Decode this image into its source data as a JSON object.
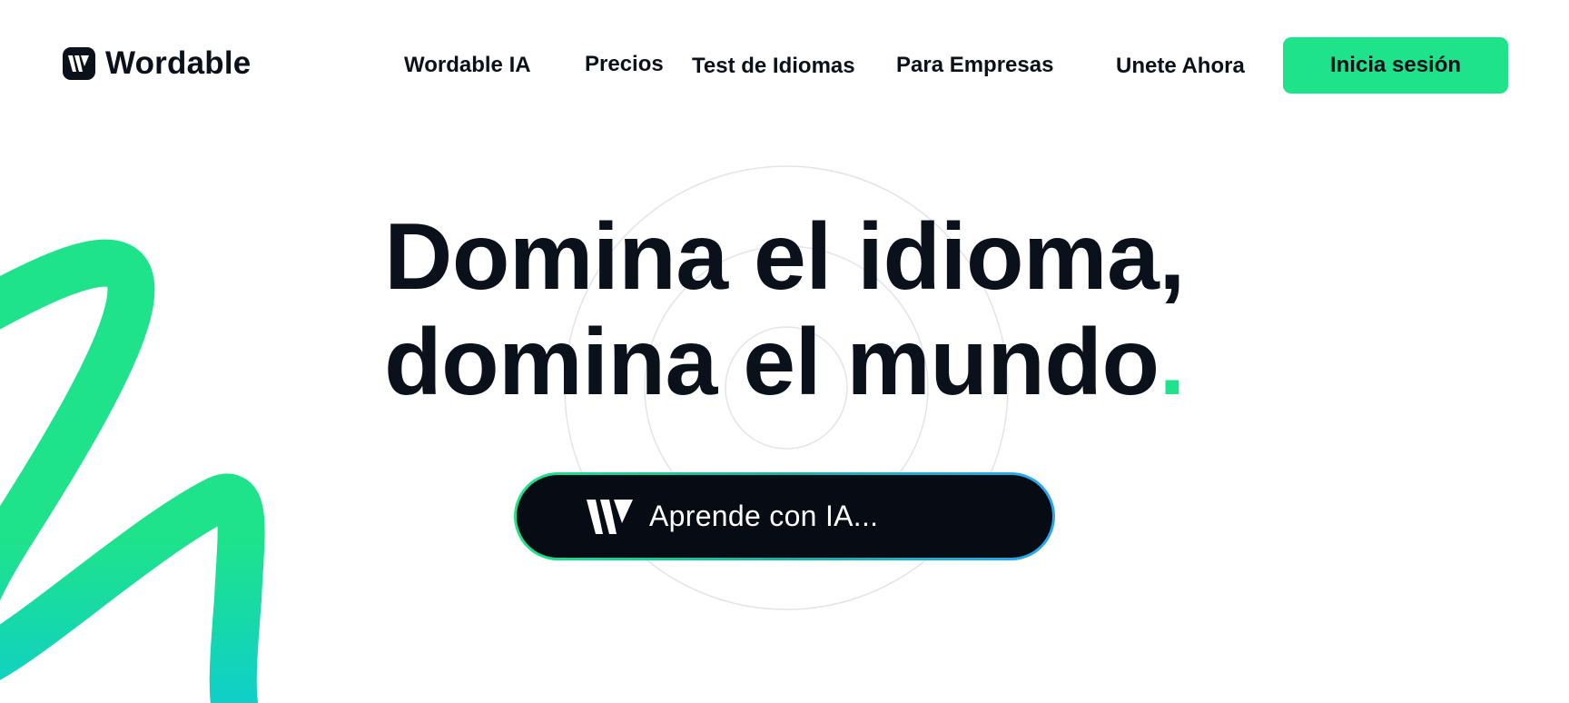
{
  "brand": {
    "name": "Wordable",
    "accent_color": "#1ee38a",
    "dark_color": "#0b111b",
    "logo_icon": "wordable-w-icon"
  },
  "nav": {
    "items": [
      {
        "label": "Wordable IA"
      },
      {
        "label": "Precios"
      },
      {
        "label": "Test de Idiomas"
      },
      {
        "label": "Para Empresas"
      },
      {
        "label": "Unete Ahora"
      }
    ],
    "login_label": "Inicia sesión"
  },
  "hero": {
    "line1": "Domina el idioma,",
    "line2": "domina el mundo",
    "dot": "."
  },
  "ai_prompt": {
    "text": "Aprende con IA...",
    "icon": "wordable-w-icon"
  }
}
